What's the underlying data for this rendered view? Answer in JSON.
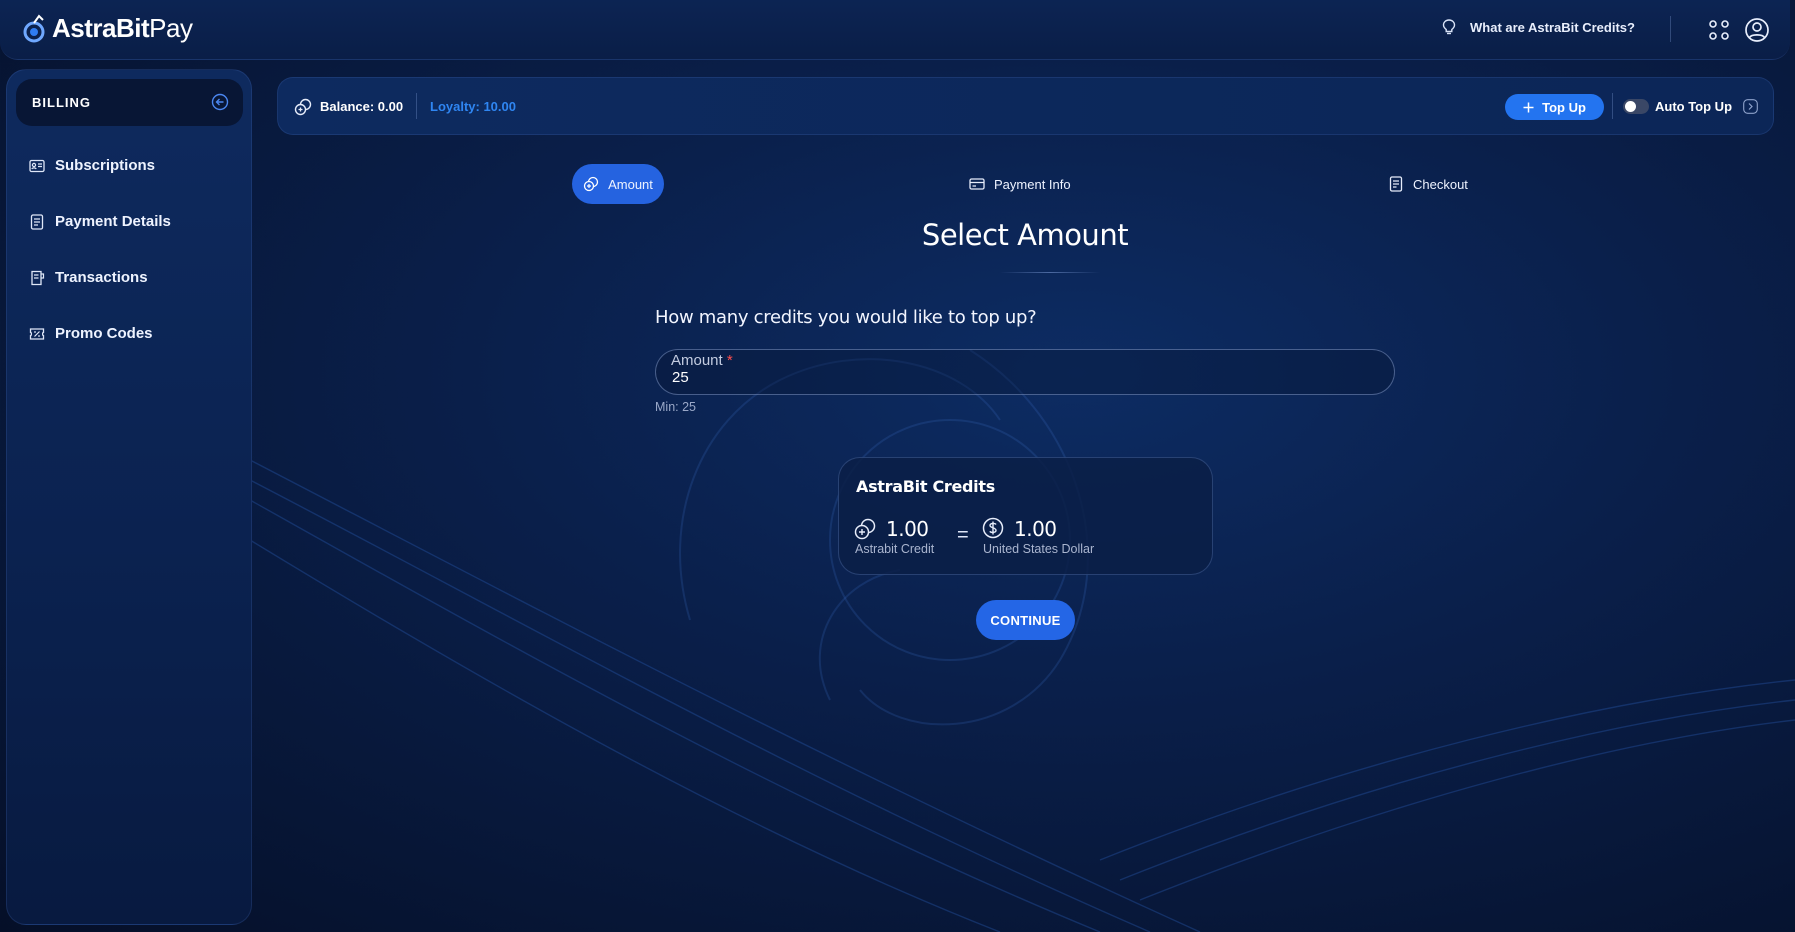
{
  "header": {
    "logo_text_bold": "AstraBit",
    "logo_text_light": "Pay",
    "help_link": "What are AstraBit Credits?"
  },
  "sidebar": {
    "section_title": "BILLING",
    "items": [
      {
        "label": "Subscriptions",
        "icon": "id-card-icon"
      },
      {
        "label": "Payment Details",
        "icon": "document-icon"
      },
      {
        "label": "Transactions",
        "icon": "receipt-icon"
      },
      {
        "label": "Promo Codes",
        "icon": "ticket-icon"
      }
    ]
  },
  "balance_bar": {
    "balance": "Balance: 0.00",
    "loyalty": "Loyalty: 10.00",
    "topup_label": "Top Up",
    "auto_topup_label": "Auto Top Up",
    "auto_topup_enabled": false
  },
  "steps": [
    {
      "label": "Amount",
      "icon": "coins-icon",
      "active": true
    },
    {
      "label": "Payment Info",
      "icon": "card-icon",
      "active": false
    },
    {
      "label": "Checkout",
      "icon": "receipt-icon",
      "active": false
    }
  ],
  "main": {
    "title": "Select Amount",
    "question": "How many credits you would like to top up?",
    "amount_label": "Amount",
    "amount_required_mark": "*",
    "amount_value": "25",
    "min_text": "Min:  25",
    "continue_label": "CONTINUE"
  },
  "credits_card": {
    "title": "AstraBit Credits",
    "left_value": "1.00",
    "left_unit": "Astrabit Credit",
    "equals": "=",
    "right_value": "1.00",
    "right_unit": "United States Dollar"
  },
  "colors": {
    "accent": "#2374f0",
    "loyalty": "#2f86f2",
    "background": "#0a1f4a"
  }
}
